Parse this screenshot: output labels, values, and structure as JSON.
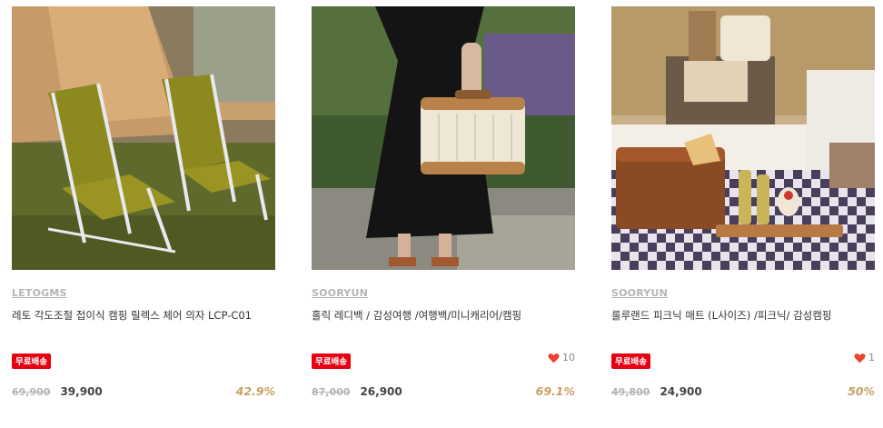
{
  "colors": {
    "accent_rate": "#c8a064",
    "badge_red": "#e60012",
    "heart": "#e9452e",
    "muted": "#b5b5b5"
  },
  "products": [
    {
      "image": "camping-chairs-photo",
      "brand": "LETOGMS",
      "title": "레토 각도조절 접이식 캠핑 릴렉스 체어 의자 LCP-C01",
      "badge": "무료배송",
      "likes": null,
      "original_price": "69,900",
      "sale_price": "39,900",
      "discount": "42.9%"
    },
    {
      "image": "mini-carrier-bag-photo",
      "brand": "SOORYUN",
      "title": "홀릭 레디백 / 감성여행 /여행백/미니캐리어/캠핑",
      "badge": "무료배송",
      "likes": "10",
      "original_price": "87,000",
      "sale_price": "26,900",
      "discount": "69.1%"
    },
    {
      "image": "picnic-mat-photo",
      "brand": "SOORYUN",
      "title": "룰루랜드 피크닉 매트 (L사이즈) /피크닉/ 감성캠핑",
      "badge": "무료배송",
      "likes": "1",
      "original_price": "49,800",
      "sale_price": "24,900",
      "discount": "50%"
    }
  ]
}
